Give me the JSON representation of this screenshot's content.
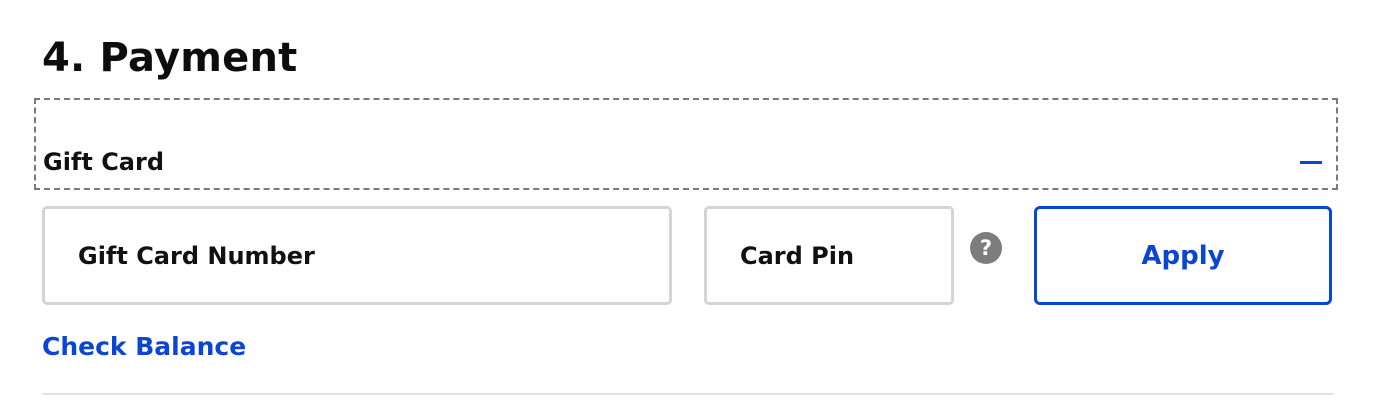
{
  "section": {
    "title": "4. Payment"
  },
  "gift_card": {
    "header_label": "Gift Card",
    "collapse_icon": "minus-icon",
    "card_number_placeholder": "Gift Card Number",
    "card_pin_placeholder": "Card Pin",
    "help_icon": "question-mark-icon",
    "help_glyph": "?",
    "apply_label": "Apply",
    "check_balance_label": "Check Balance"
  },
  "colors": {
    "accent": "#0a46d1",
    "field_border": "#d4d4d4",
    "help_icon_bg": "#7d7d7d"
  }
}
